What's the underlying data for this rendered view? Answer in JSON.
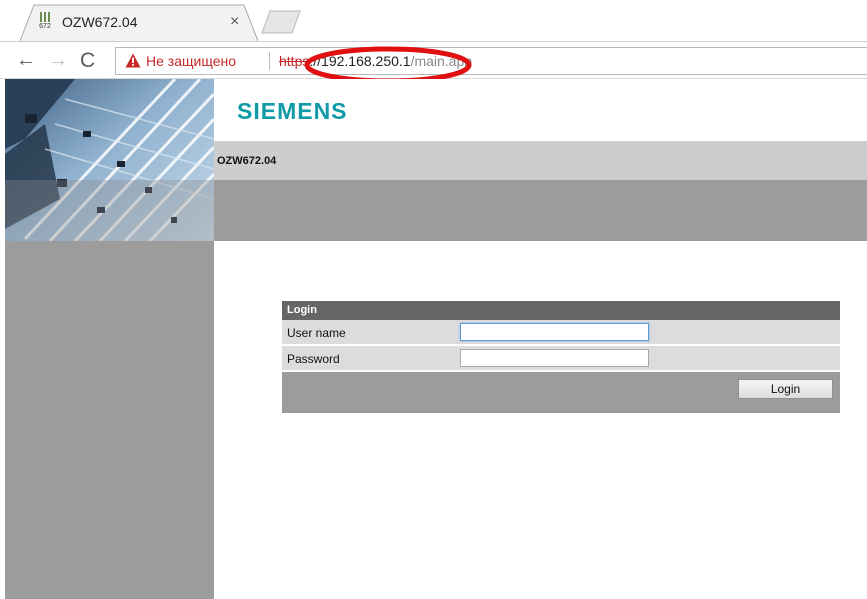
{
  "browser": {
    "tab": {
      "favicon_text": "672",
      "title": "OZW672.04",
      "close_glyph": "×"
    },
    "nav": {
      "back": "←",
      "forward": "→",
      "reload": "C"
    },
    "address": {
      "security_warning": "Не защищено",
      "url_scheme": "https",
      "url_separator": "://",
      "url_host": "192.168.250.1",
      "url_path": "/main.app"
    },
    "icons": [
      "warning-triangle-icon",
      "back-arrow-icon",
      "forward-arrow-icon",
      "reload-icon",
      "close-icon"
    ]
  },
  "page": {
    "brand": "SIEMENS",
    "device_name": "OZW672.04",
    "login": {
      "title": "Login",
      "username_label": "User name",
      "username_value": "",
      "password_label": "Password",
      "password_value": "",
      "button_label": "Login"
    }
  },
  "colors": {
    "brand": "#0f9aa6",
    "warning": "#c62828",
    "annotation": "#e01010",
    "panel_gray": "#9c9c9c",
    "bar_gray": "#cdcdcd",
    "header_dark": "#666666"
  }
}
